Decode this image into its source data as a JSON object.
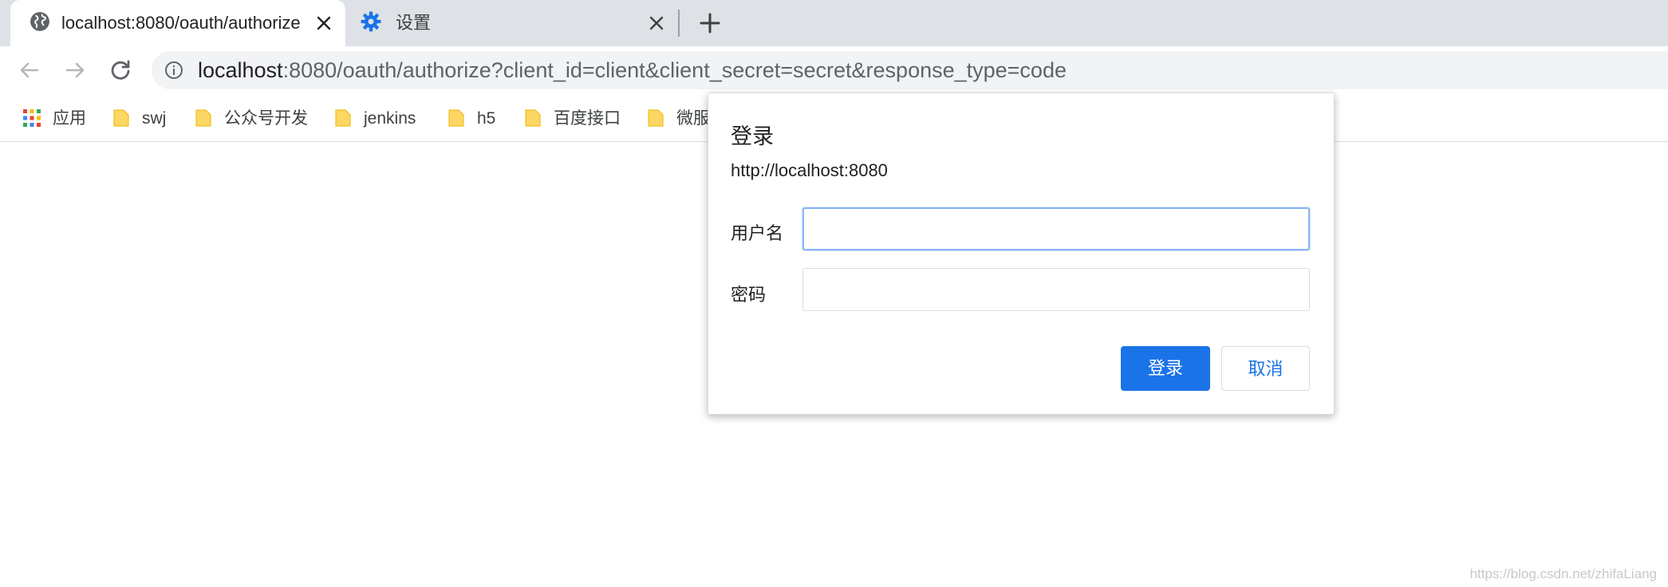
{
  "tabs": [
    {
      "title": "localhost:8080/oauth/authorize",
      "icon": "globe-icon",
      "active": true
    },
    {
      "title": "设置",
      "icon": "gear-icon",
      "active": false
    }
  ],
  "address_bar": {
    "host": "localhost",
    "rest": ":8080/oauth/authorize?client_id=client&client_secret=secret&response_type=code"
  },
  "bookmarks": [
    {
      "label": "应用",
      "icon": "apps-grid-icon"
    },
    {
      "label": "swj",
      "icon": "folder-icon"
    },
    {
      "label": "公众号开发",
      "icon": "folder-icon"
    },
    {
      "label": "jenkins",
      "icon": "folder-icon"
    },
    {
      "label": "h5",
      "icon": "folder-icon"
    },
    {
      "label": "百度接口",
      "icon": "folder-icon"
    },
    {
      "label": "微服",
      "icon": "folder-icon"
    }
  ],
  "login_dialog": {
    "title": "登录",
    "origin": "http://localhost:8080",
    "username_label": "用户名",
    "username_value": "",
    "password_label": "密码",
    "password_value": "",
    "submit_label": "登录",
    "cancel_label": "取消"
  },
  "watermark": "https://blog.csdn.net/zhifaLiang",
  "colors": {
    "accent": "#1a73e8",
    "tabstrip": "#dee1e6",
    "omnibox": "#f1f3f4",
    "folder": "#fdd663"
  }
}
